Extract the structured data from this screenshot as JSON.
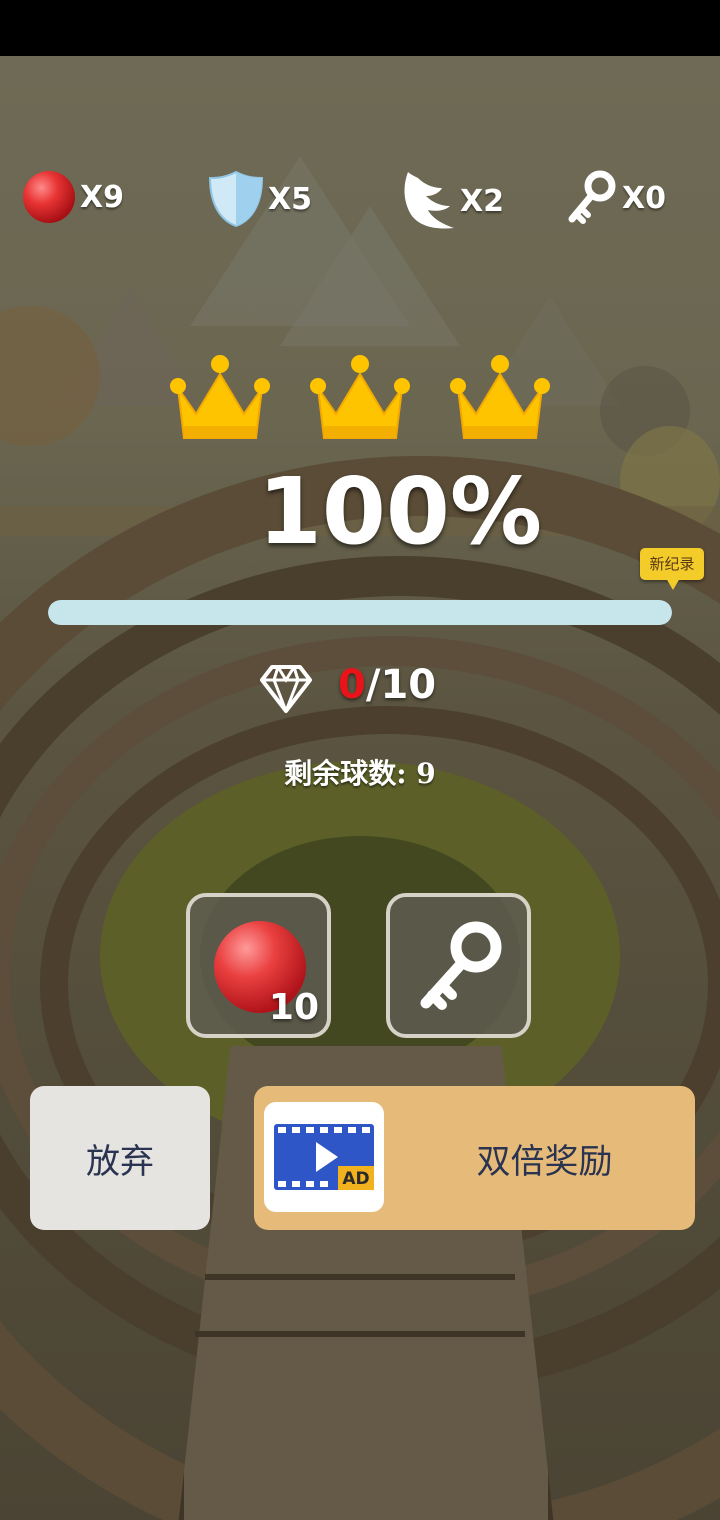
{
  "resources": [
    {
      "icon": "red-ball-icon",
      "count": "X9"
    },
    {
      "icon": "shield-icon",
      "count": "X5"
    },
    {
      "icon": "wing-icon",
      "count": "X2"
    },
    {
      "icon": "key-icon",
      "count": "X0"
    }
  ],
  "result": {
    "crowns_earned": 3,
    "percent_label": "100%",
    "progress": 1.0,
    "new_record_badge": "新纪录"
  },
  "gems": {
    "collected": "0",
    "separator_total": "/10"
  },
  "remaining_balls_label": "剩余球数: 9",
  "powerups": {
    "ball_count": "10"
  },
  "buttons": {
    "give_up": "放弃",
    "double_reward": "双倍奖励",
    "ad_badge": "AD"
  },
  "colors": {
    "gem_collected": "#e8141a",
    "progress_fill": "#c6e6ec",
    "double_button": "#e6bb79",
    "give_up_button": "#e6e4e0",
    "badge": "#f4cc2a"
  }
}
